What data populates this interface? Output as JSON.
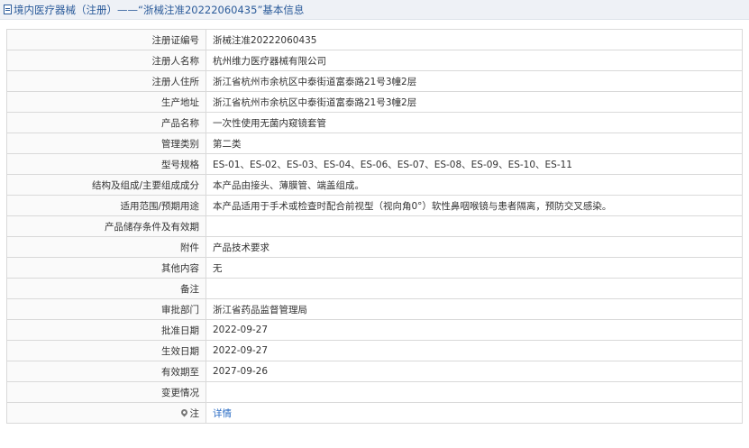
{
  "header": {
    "title": "境内医疗器械（注册）——“浙械注准20222060435”基本信息",
    "icon": "document-icon"
  },
  "rows": [
    {
      "label": "注册证编号",
      "value": "浙械注准20222060435"
    },
    {
      "label": "注册人名称",
      "value": "杭州维力医疗器械有限公司"
    },
    {
      "label": "注册人住所",
      "value": "浙江省杭州市余杭区中泰街道富泰路21号3幢2层"
    },
    {
      "label": "生产地址",
      "value": "浙江省杭州市余杭区中泰街道富泰路21号3幢2层"
    },
    {
      "label": "产品名称",
      "value": "一次性使用无菌内窥镜套管"
    },
    {
      "label": "管理类别",
      "value": "第二类"
    },
    {
      "label": "型号规格",
      "value": "ES-01、ES-02、ES-03、ES-04、ES-06、ES-07、ES-08、ES-09、ES-10、ES-11"
    },
    {
      "label": "结构及组成/主要组成成分",
      "value": "本产品由接头、薄膜管、端盖组成。"
    },
    {
      "label": "适用范围/预期用途",
      "value": "本产品适用于手术或检查时配合前视型（视向角0°）软性鼻咽喉镜与患者隔离，预防交叉感染。"
    },
    {
      "label": "产品储存条件及有效期",
      "value": ""
    },
    {
      "label": "附件",
      "value": "产品技术要求"
    },
    {
      "label": "其他内容",
      "value": "无"
    },
    {
      "label": "备注",
      "value": ""
    },
    {
      "label": "审批部门",
      "value": "浙江省药品监督管理局"
    },
    {
      "label": "批准日期",
      "value": "2022-09-27"
    },
    {
      "label": "生效日期",
      "value": "2022-09-27"
    },
    {
      "label": "有效期至",
      "value": "2027-09-26"
    },
    {
      "label": "变更情况",
      "value": ""
    }
  ],
  "note": {
    "label": "注",
    "icon": "pin-icon",
    "link_text": "详情"
  }
}
